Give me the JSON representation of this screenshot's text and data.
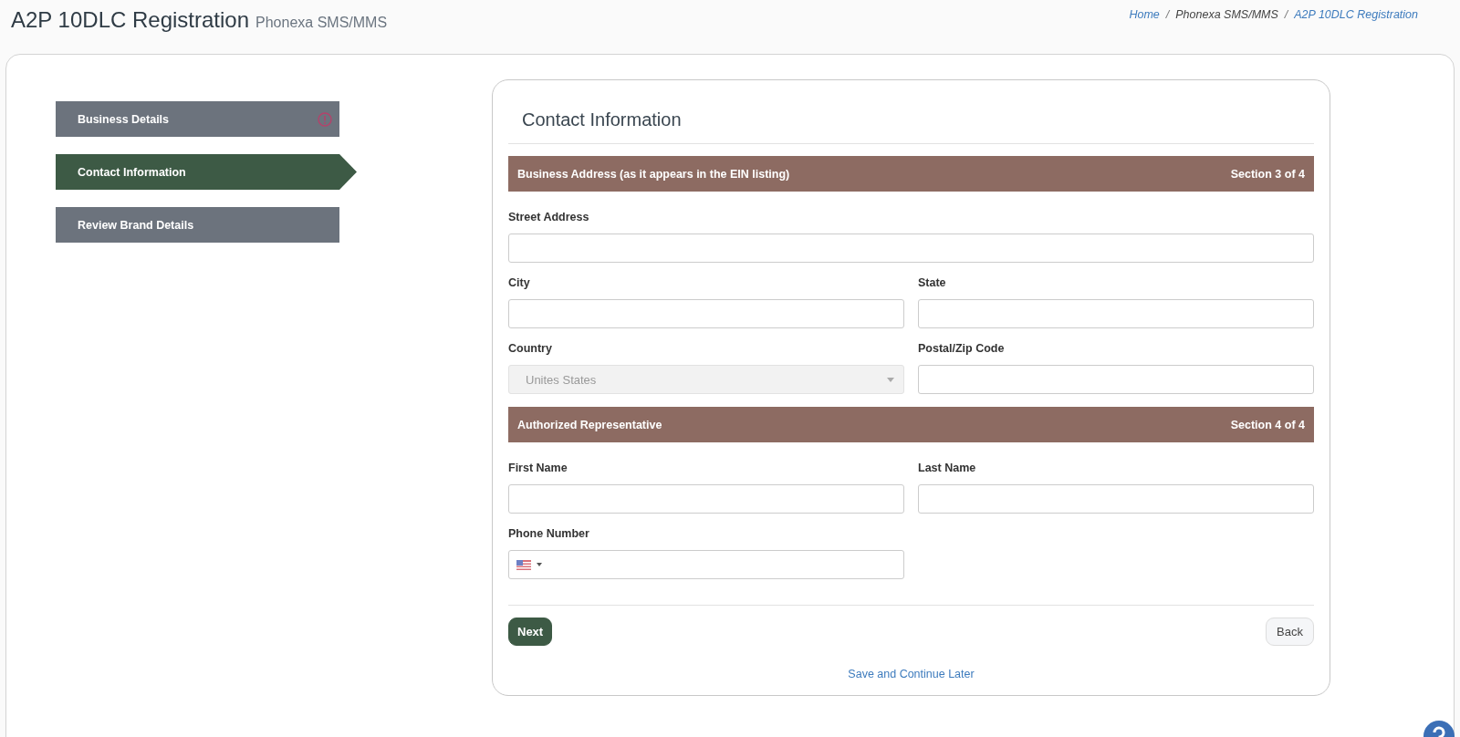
{
  "header": {
    "title": "A2P 10DLC Registration",
    "subtitle": "Phonexa SMS/MMS"
  },
  "breadcrumbs": [
    {
      "label": "Home",
      "link": true
    },
    {
      "label": "Phonexa SMS/MMS",
      "link": false
    },
    {
      "label": "A2P 10DLC Registration",
      "link": true
    }
  ],
  "breadcrumb_separator": "/",
  "steps": [
    {
      "label": "Business Details",
      "selected": false,
      "warning": true
    },
    {
      "label": "Contact Information",
      "selected": true,
      "warning": false
    },
    {
      "label": "Review Brand Details",
      "selected": false,
      "warning": false
    }
  ],
  "card": {
    "title": "Contact Information",
    "sections": [
      {
        "title": "Business Address (as it appears in the EIN listing)",
        "section_label": "Section 3 of 4",
        "rows": [
          [
            {
              "label": "Street Address",
              "kind": "text"
            }
          ],
          [
            {
              "label": "City",
              "kind": "text"
            },
            {
              "label": "State",
              "kind": "text"
            }
          ],
          [
            {
              "label": "Country",
              "kind": "select",
              "value": "Unites States",
              "disabled": true
            },
            {
              "label": "Postal/Zip Code",
              "kind": "text"
            }
          ]
        ]
      },
      {
        "title": "Authorized Representative",
        "section_label": "Section 4 of 4",
        "rows": [
          [
            {
              "label": "First Name",
              "kind": "text"
            },
            {
              "label": "Last Name",
              "kind": "text"
            }
          ],
          [
            {
              "label": "Phone Number",
              "kind": "phone"
            }
          ]
        ]
      }
    ],
    "next_button": "Next",
    "back_button": "Back",
    "save_link": "Save and Continue Later"
  }
}
